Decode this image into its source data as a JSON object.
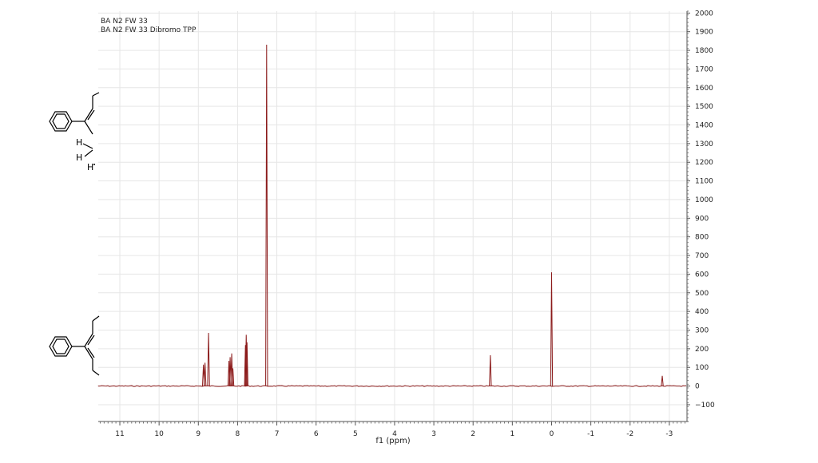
{
  "header": {
    "line1": "BA N2 FW 33",
    "line2": "BA N2 FW 33 Dibromo TPP"
  },
  "structure_labels": {
    "h1": "H",
    "h2": "H",
    "h3": "H"
  },
  "chart_data": {
    "type": "line",
    "title": "",
    "xlabel": "f1 (ppm)",
    "ylabel": "",
    "xlim": [
      11.55,
      -3.45
    ],
    "ylim": [
      -190,
      2010
    ],
    "x_ticks": [
      11,
      10,
      9,
      8,
      7,
      6,
      5,
      4,
      3,
      2,
      1,
      0,
      -1,
      -2,
      -3
    ],
    "y_ticks": [
      -100,
      0,
      100,
      200,
      300,
      400,
      500,
      600,
      700,
      800,
      900,
      1000,
      1100,
      1200,
      1300,
      1400,
      1500,
      1600,
      1700,
      1800,
      1900,
      2000
    ],
    "grid": true,
    "color": "#8b1a1a",
    "peaks": [
      {
        "x": 8.87,
        "y": 115
      },
      {
        "x": 8.83,
        "y": 125
      },
      {
        "x": 8.74,
        "y": 285
      },
      {
        "x": 8.22,
        "y": 135
      },
      {
        "x": 8.19,
        "y": 155
      },
      {
        "x": 8.15,
        "y": 175
      },
      {
        "x": 8.12,
        "y": 95
      },
      {
        "x": 7.8,
        "y": 220
      },
      {
        "x": 7.78,
        "y": 275
      },
      {
        "x": 7.76,
        "y": 235
      },
      {
        "x": 7.26,
        "y": 1830
      },
      {
        "x": 1.56,
        "y": 165
      },
      {
        "x": 0.0,
        "y": 610
      },
      {
        "x": -2.82,
        "y": 55
      }
    ]
  }
}
